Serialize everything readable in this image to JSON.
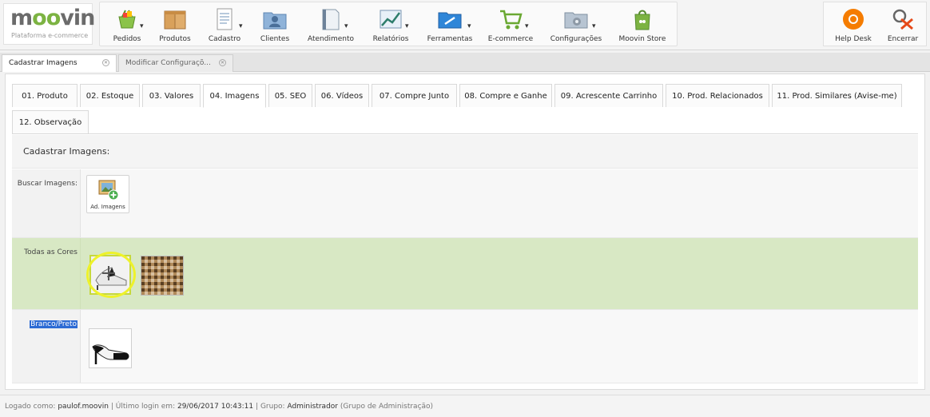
{
  "brand": {
    "logo_text": "moovin",
    "logo_sub": "Plataforma e-commerce",
    "accent_color": "#7cb342"
  },
  "toolbar": {
    "items": [
      {
        "label": "Pedidos",
        "icon": "basket-icon"
      },
      {
        "label": "Produtos",
        "icon": "boxes-icon"
      },
      {
        "label": "Cadastro",
        "icon": "document-icon"
      },
      {
        "label": "Clientes",
        "icon": "contacts-folder-icon"
      },
      {
        "label": "Atendimento",
        "icon": "notebook-icon"
      },
      {
        "label": "Relatórios",
        "icon": "report-chart-icon"
      },
      {
        "label": "Ferramentas",
        "icon": "tools-folder-icon"
      },
      {
        "label": "E-commerce",
        "icon": "shopping-cart-icon"
      },
      {
        "label": "Configurações",
        "icon": "settings-folder-icon"
      },
      {
        "label": "Moovin Store",
        "icon": "store-bag-icon"
      }
    ],
    "right": [
      {
        "label": "Help Desk",
        "icon": "lifebuoy-icon"
      },
      {
        "label": "Encerrar",
        "icon": "logout-icon"
      }
    ]
  },
  "doc_tabs": [
    {
      "label": "Cadastrar Imagens",
      "active": true
    },
    {
      "label": "Modificar Configuraçõ...",
      "active": false
    }
  ],
  "product_tabs": {
    "row1": [
      "01. Produto",
      "02. Estoque",
      "03. Valores",
      "04. Imagens",
      "05. SEO",
      "06. Vídeos",
      "07. Compre Junto",
      "08. Compre e Ganhe",
      "09. Acrescente Carrinho",
      "10. Prod. Relacionados",
      "11. Prod. Similares (Avise-me)"
    ],
    "row2": [
      "12. Observação"
    ],
    "active": "04. Imagens"
  },
  "section": {
    "title": "Cadastrar Imagens:",
    "search_label": "Buscar Imagens:",
    "add_button_label": "Ad. Imagens",
    "groups": [
      {
        "label": "Todas as Cores",
        "highlight_color": "#d8e8c4",
        "images": [
          "shoe-photo",
          "pattern-photo"
        ]
      },
      {
        "label": "Branco/Preto",
        "images": [
          "shoe-photo"
        ]
      }
    ]
  },
  "status": {
    "logged_label": "Logado como:",
    "user": "paulof.moovin",
    "last_login_label": "Último login em:",
    "last_login": "29/06/2017 10:43:11",
    "group_label": "Grupo:",
    "group": "Administrador",
    "group_desc": "(Grupo de Administração)"
  }
}
